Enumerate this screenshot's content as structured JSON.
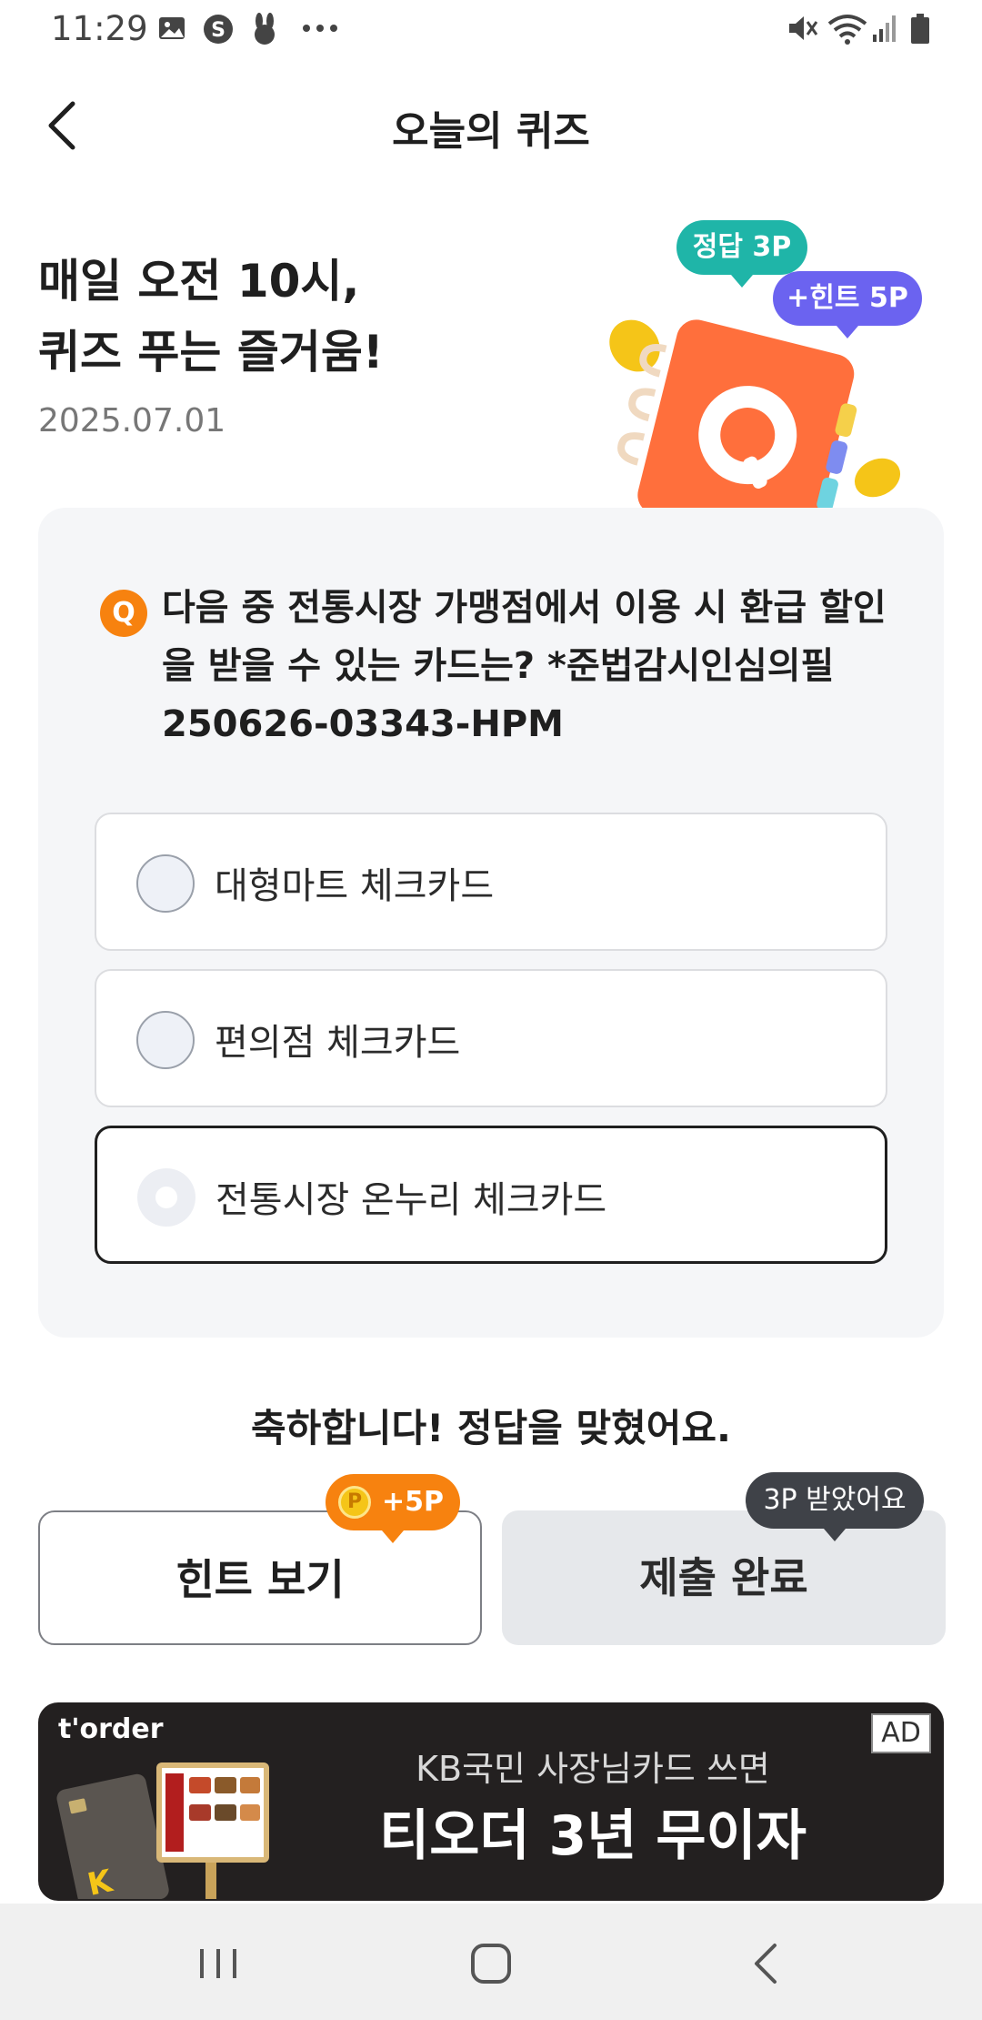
{
  "status_bar": {
    "time": "11:29",
    "icons": [
      "gallery-icon",
      "s-app-icon",
      "rabbit-icon",
      "more-dots-icon",
      "mute-icon",
      "wifi-icon",
      "signal-icon",
      "battery-icon"
    ]
  },
  "header": {
    "title": "오늘의 퀴즈",
    "back_icon": "chevron-left-icon"
  },
  "hero": {
    "title": "매일 오전 10시,\n퀴즈 푸는 즐거움!",
    "date": "2025.07.01",
    "bubble_answer": "정답 3P",
    "bubble_hint": "+힌트 5P",
    "illustration": "quiz-notebook-icon"
  },
  "quiz": {
    "badge": "Q",
    "question": "다음 중 전통시장 가맹점에서 이용 시 환급 할인을 받을 수 있는 카드는? *준법감시인심의필 250626-03343-HPM",
    "options": [
      {
        "label": "대형마트 체크카드",
        "selected": false
      },
      {
        "label": "편의점 체크카드",
        "selected": false
      },
      {
        "label": "전통시장 온누리 체크카드",
        "selected": true
      }
    ]
  },
  "result_message": "축하합니다! 정답을 맞혔어요.",
  "buttons": {
    "hint_label": "힌트 보기",
    "hint_tag_points": "+5P",
    "hint_tag_coin": "P",
    "submit_label": "제출 완료",
    "submit_tag": "3P 받았어요"
  },
  "ad": {
    "brand": "t'order",
    "label": "AD",
    "subtitle": "KB국민 사장님카드 쓰면",
    "headline": "티오더 3년 무이자"
  },
  "nav_bar": {
    "icons": [
      "recents-icon",
      "home-icon",
      "back-icon"
    ]
  },
  "colors": {
    "accent_orange": "#f7820f",
    "bubble_teal": "#1fb5a8",
    "bubble_purple": "#6b63f0",
    "tag_dark": "#3f4248"
  }
}
